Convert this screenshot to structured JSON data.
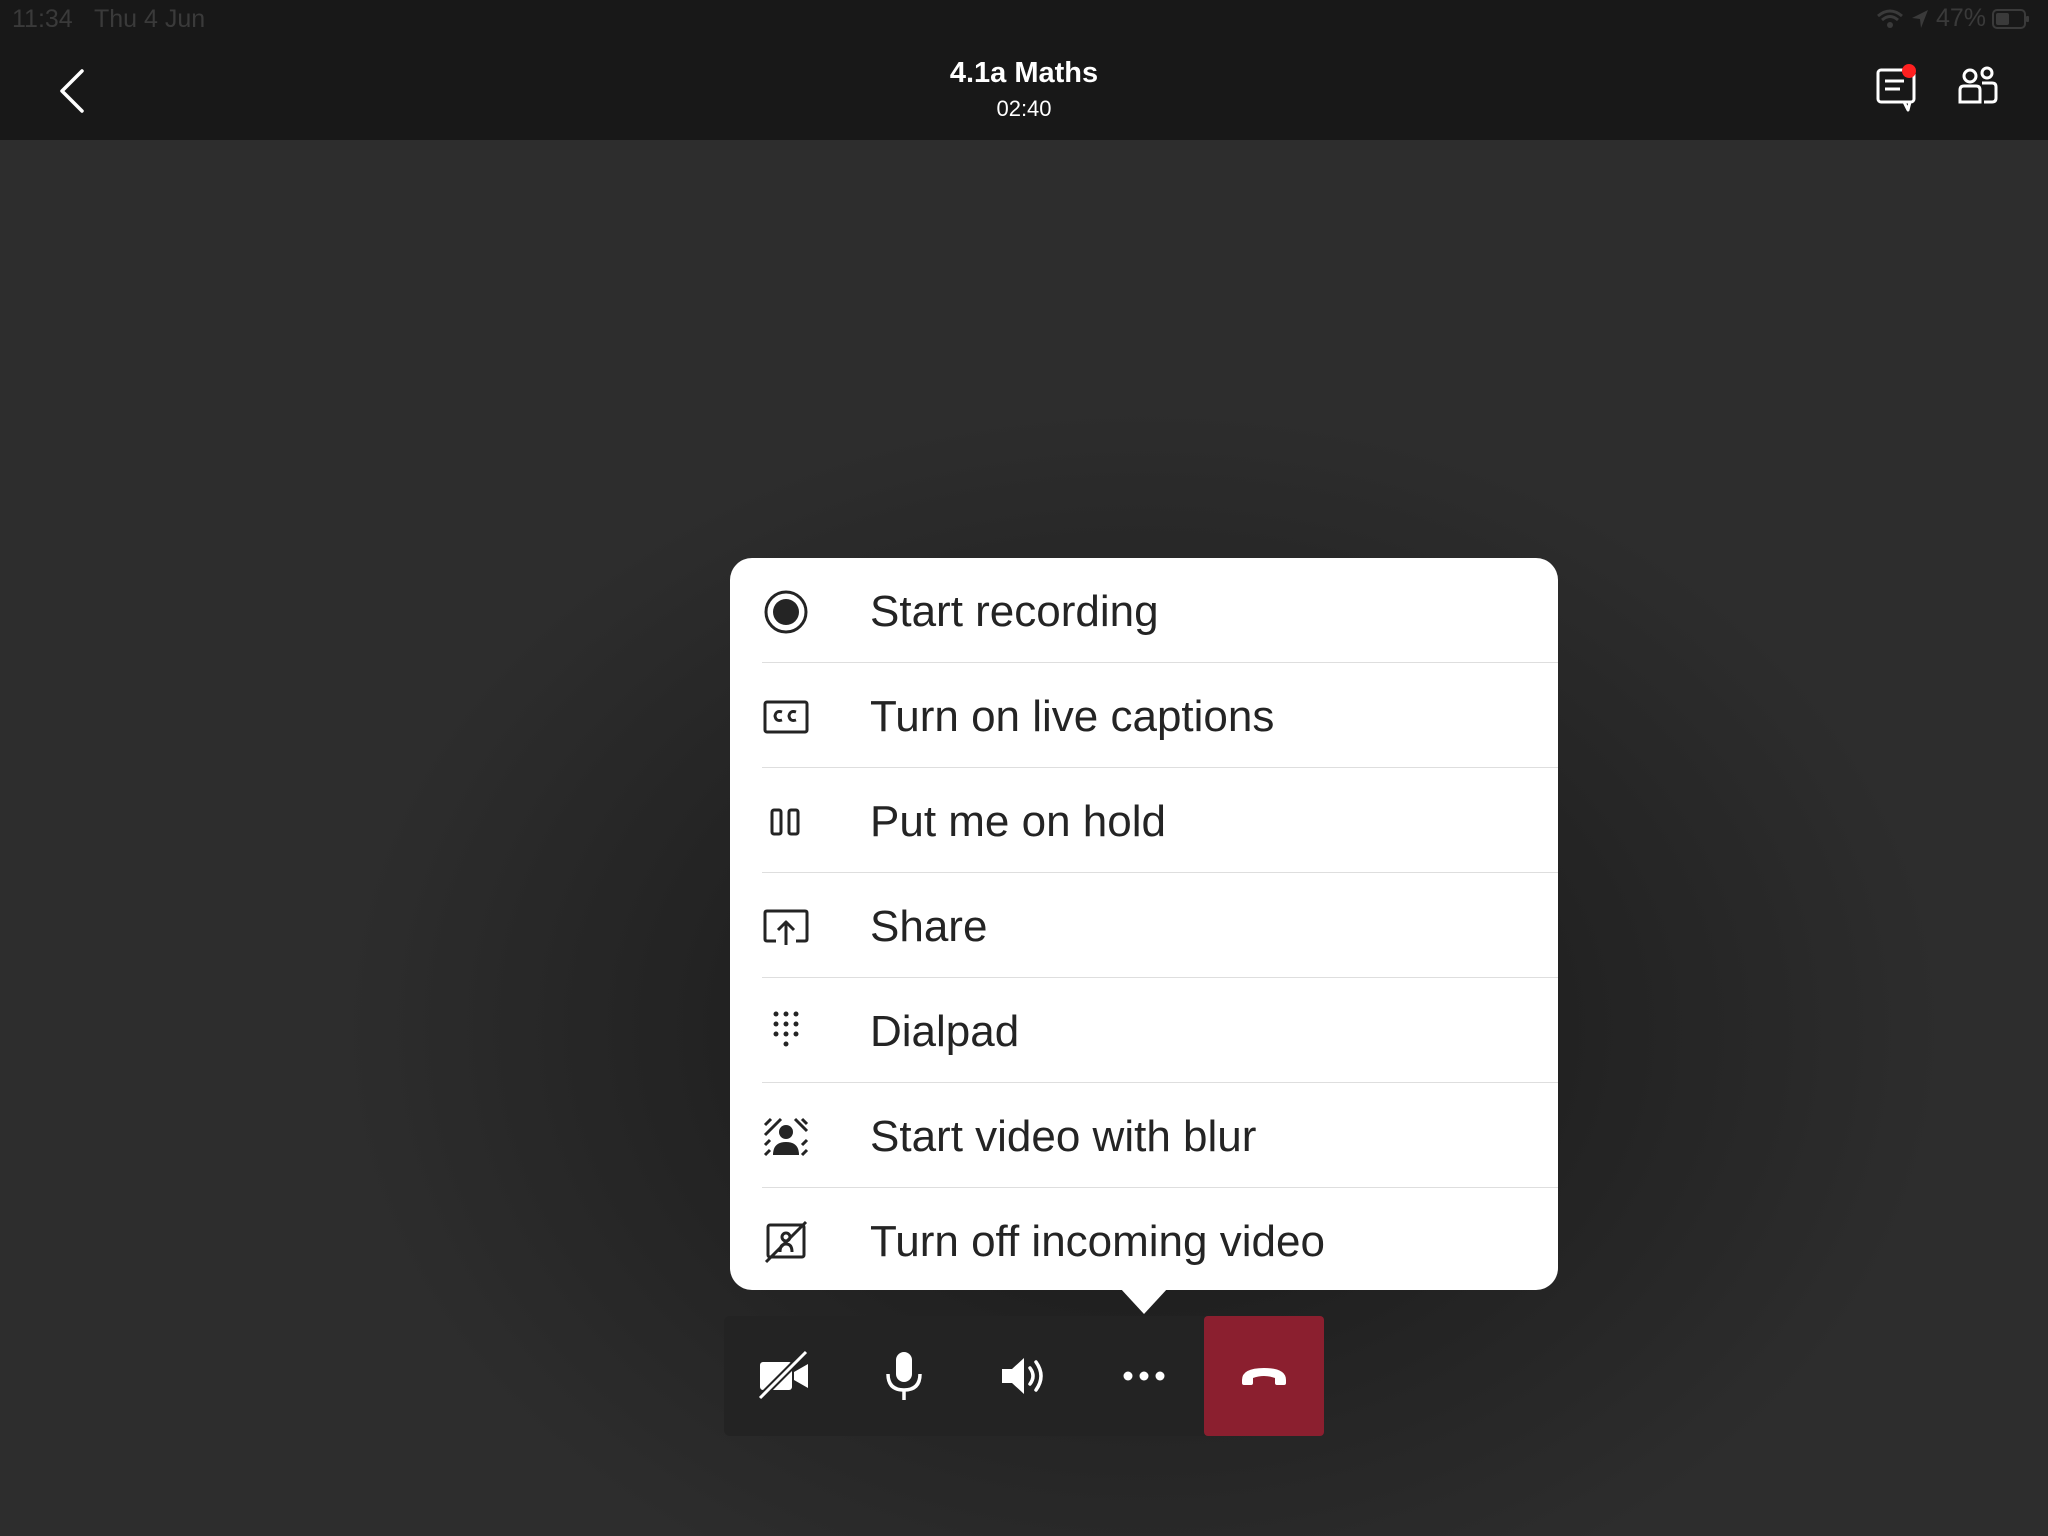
{
  "status_bar": {
    "time": "11:34",
    "date": "Thu 4 Jun",
    "battery": "47%"
  },
  "header": {
    "title": "4.1a Maths",
    "timer": "02:40"
  },
  "menu": {
    "items": [
      {
        "label": "Start recording",
        "icon": "record-icon"
      },
      {
        "label": "Turn on live captions",
        "icon": "captions-icon"
      },
      {
        "label": "Put me on hold",
        "icon": "hold-icon"
      },
      {
        "label": "Share",
        "icon": "share-screen-icon"
      },
      {
        "label": "Dialpad",
        "icon": "dialpad-icon"
      },
      {
        "label": "Start video with blur",
        "icon": "blur-background-icon"
      },
      {
        "label": "Turn off incoming video",
        "icon": "incoming-video-off-icon"
      }
    ]
  },
  "controls": [
    {
      "name": "camera-off",
      "icon": "camera-off-icon"
    },
    {
      "name": "microphone",
      "icon": "microphone-icon"
    },
    {
      "name": "speaker",
      "icon": "speaker-icon"
    },
    {
      "name": "more-options",
      "icon": "more-icon"
    },
    {
      "name": "hang-up",
      "icon": "hang-up-icon"
    }
  ],
  "colors": {
    "background": "#2d2d2d",
    "header": "#181818",
    "menu": "#ffffff",
    "menu_text": "#242424",
    "hangup": "#8b1f2f",
    "notification": "#ff2020"
  }
}
